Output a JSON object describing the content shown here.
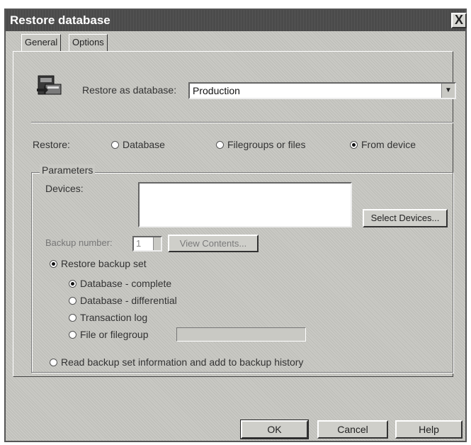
{
  "window": {
    "title": "Restore database",
    "close_label": "X"
  },
  "tabs": [
    {
      "label": "General"
    },
    {
      "label": "Options"
    }
  ],
  "restore_as": {
    "label": "Restore as database:",
    "value": "Production",
    "icon": "database-restore-icon"
  },
  "restore": {
    "label": "Restore:",
    "options": [
      {
        "label": "Database",
        "selected": false
      },
      {
        "label": "Filegroups or files",
        "selected": false
      },
      {
        "label": "From device",
        "selected": true
      }
    ]
  },
  "parameters": {
    "group_title": "Parameters",
    "devices_label": "Devices:",
    "devices_list": [],
    "select_devices_label": "Select Devices...",
    "backup_number_label": "Backup number:",
    "backup_number_value": "1",
    "view_contents_label": "View Contents...",
    "restore_backup_set": {
      "label": "Restore backup set",
      "selected": true,
      "options": [
        {
          "label": "Database - complete",
          "selected": true
        },
        {
          "label": "Database - differential",
          "selected": false
        },
        {
          "label": "Transaction log",
          "selected": false
        },
        {
          "label": "File or filegroup",
          "selected": false
        }
      ],
      "filegroup_value": ""
    },
    "read_backup_info": {
      "label": "Read backup set information and add to backup history",
      "selected": false
    }
  },
  "buttons": {
    "ok": "OK",
    "cancel": "Cancel",
    "help": "Help"
  },
  "colors": {
    "dialog_bg": "#c9c9c4",
    "titlebar": "#4b4b4b",
    "field_bg": "#ffffff"
  }
}
